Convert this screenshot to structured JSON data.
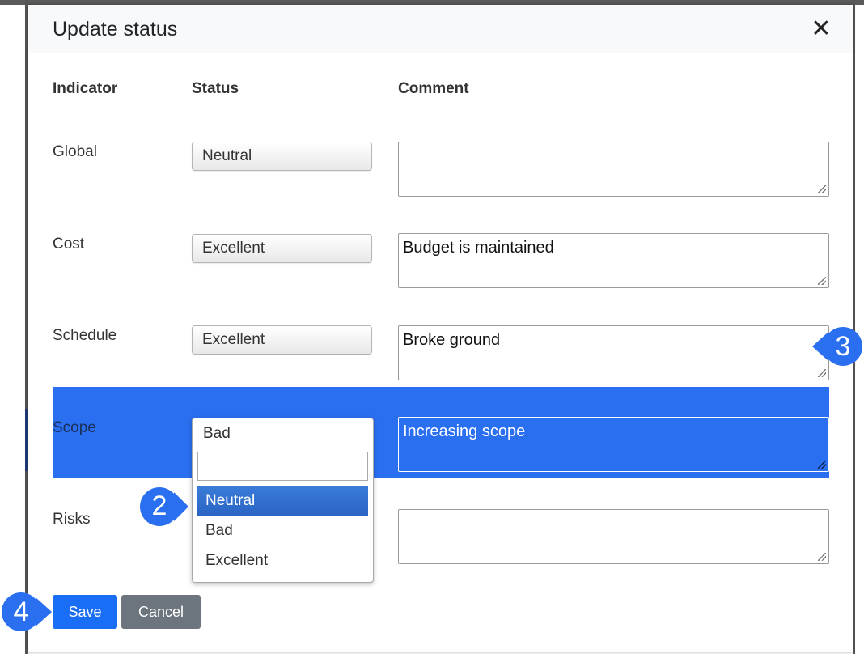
{
  "modal": {
    "title": "Update status",
    "close_label": "✕"
  },
  "columns": {
    "indicator": "Indicator",
    "status": "Status",
    "comment": "Comment"
  },
  "rows": [
    {
      "label": "Global",
      "status": "Neutral",
      "comment": ""
    },
    {
      "label": "Cost",
      "status": "Excellent",
      "comment": "Budget is maintained"
    },
    {
      "label": "Schedule",
      "status": "Excellent",
      "comment": "Broke ground"
    },
    {
      "label": "Scope",
      "status": "Bad",
      "comment": "Increasing scope"
    },
    {
      "label": "Risks",
      "status": "",
      "comment": ""
    }
  ],
  "dropdown": {
    "current": "Bad",
    "search_value": "",
    "options": [
      "Neutral",
      "Bad",
      "Excellent"
    ],
    "highlighted": "Neutral"
  },
  "buttons": {
    "save": "Save",
    "cancel": "Cancel"
  },
  "callouts": [
    "2",
    "3",
    "4"
  ],
  "colors": {
    "accent": "#2a6ff0",
    "save_button": "#1a6ef5",
    "cancel_button": "#6c757d",
    "callout": "#2a6ff0"
  }
}
